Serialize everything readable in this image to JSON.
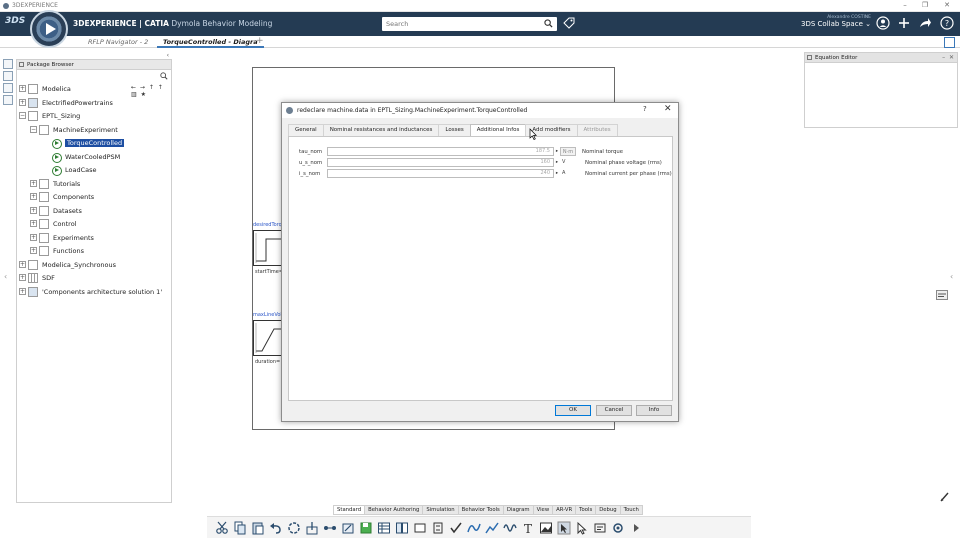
{
  "os_title": "3DEXPERIENCE",
  "topbar": {
    "brand_logo": "3DS",
    "app_title_bold": "3DEXPERIENCE | CATIA",
    "app_title_rest": " Dymola Behavior Modeling",
    "search_placeholder": "Search",
    "user_name": "Alexandre COSTINE",
    "collab_space": "3DS Collab Space"
  },
  "tabs": [
    {
      "label": "RFLP Navigator - 2"
    },
    {
      "label": "TorqueControlled - Diagra"
    }
  ],
  "tab_add": "+",
  "package_browser": {
    "title": "Package Browser",
    "items": [
      {
        "label": "Modelica"
      },
      {
        "label": "ElectrifiedPowertrains"
      },
      {
        "label": "EPTL_Sizing"
      },
      {
        "label": "MachineExperiment"
      },
      {
        "label": "TorqueControlled"
      },
      {
        "label": "WaterCooledPSM"
      },
      {
        "label": "LoadCase"
      },
      {
        "label": "Tutorials"
      },
      {
        "label": "Components"
      },
      {
        "label": "Datasets"
      },
      {
        "label": "Control"
      },
      {
        "label": "Experiments"
      },
      {
        "label": "Functions"
      },
      {
        "label": "Modelica_Synchronous"
      },
      {
        "label": "SDF"
      },
      {
        "label": "'Components architecture solution 1'"
      }
    ]
  },
  "diagram": {
    "label1": "desiredTorq",
    "text1": "startTime=",
    "label2": "maxLineVolt",
    "text2": "duration="
  },
  "equation_editor": {
    "title": "Equation Editor"
  },
  "dialog": {
    "title": "redeclare machine.data in EPTL_Sizing.MachineExperiment.TorqueControlled",
    "help": "?",
    "close": "✕",
    "tabs": [
      {
        "label": "General"
      },
      {
        "label": "Nominal resistances and inductances"
      },
      {
        "label": "Losses"
      },
      {
        "label": "Additional Infos"
      },
      {
        "label": "Add modifiers"
      },
      {
        "label": "Attributes"
      }
    ],
    "params": [
      {
        "name": "tau_nom",
        "value": "187.5",
        "unit": "N·m",
        "desc": "Nominal torque"
      },
      {
        "name": "u_s_nom",
        "value": "160",
        "unit": "V",
        "desc": "Nominal phase voltage (rms)"
      },
      {
        "name": "i_s_nom",
        "value": "240",
        "unit": "A",
        "desc": "Nominal current per phase (rms)"
      }
    ],
    "buttons": {
      "ok": "OK",
      "cancel": "Cancel",
      "info": "Info"
    }
  },
  "ribbon_tabs": [
    "Standard",
    "Behavior Authoring",
    "Simulation",
    "Behavior Tools",
    "Diagram",
    "View",
    "AR-VR",
    "Tools",
    "Debug",
    "Touch"
  ],
  "colors": {
    "topbar": "#243b53",
    "selection": "#1d4ea2",
    "accent": "#3b78b8"
  }
}
